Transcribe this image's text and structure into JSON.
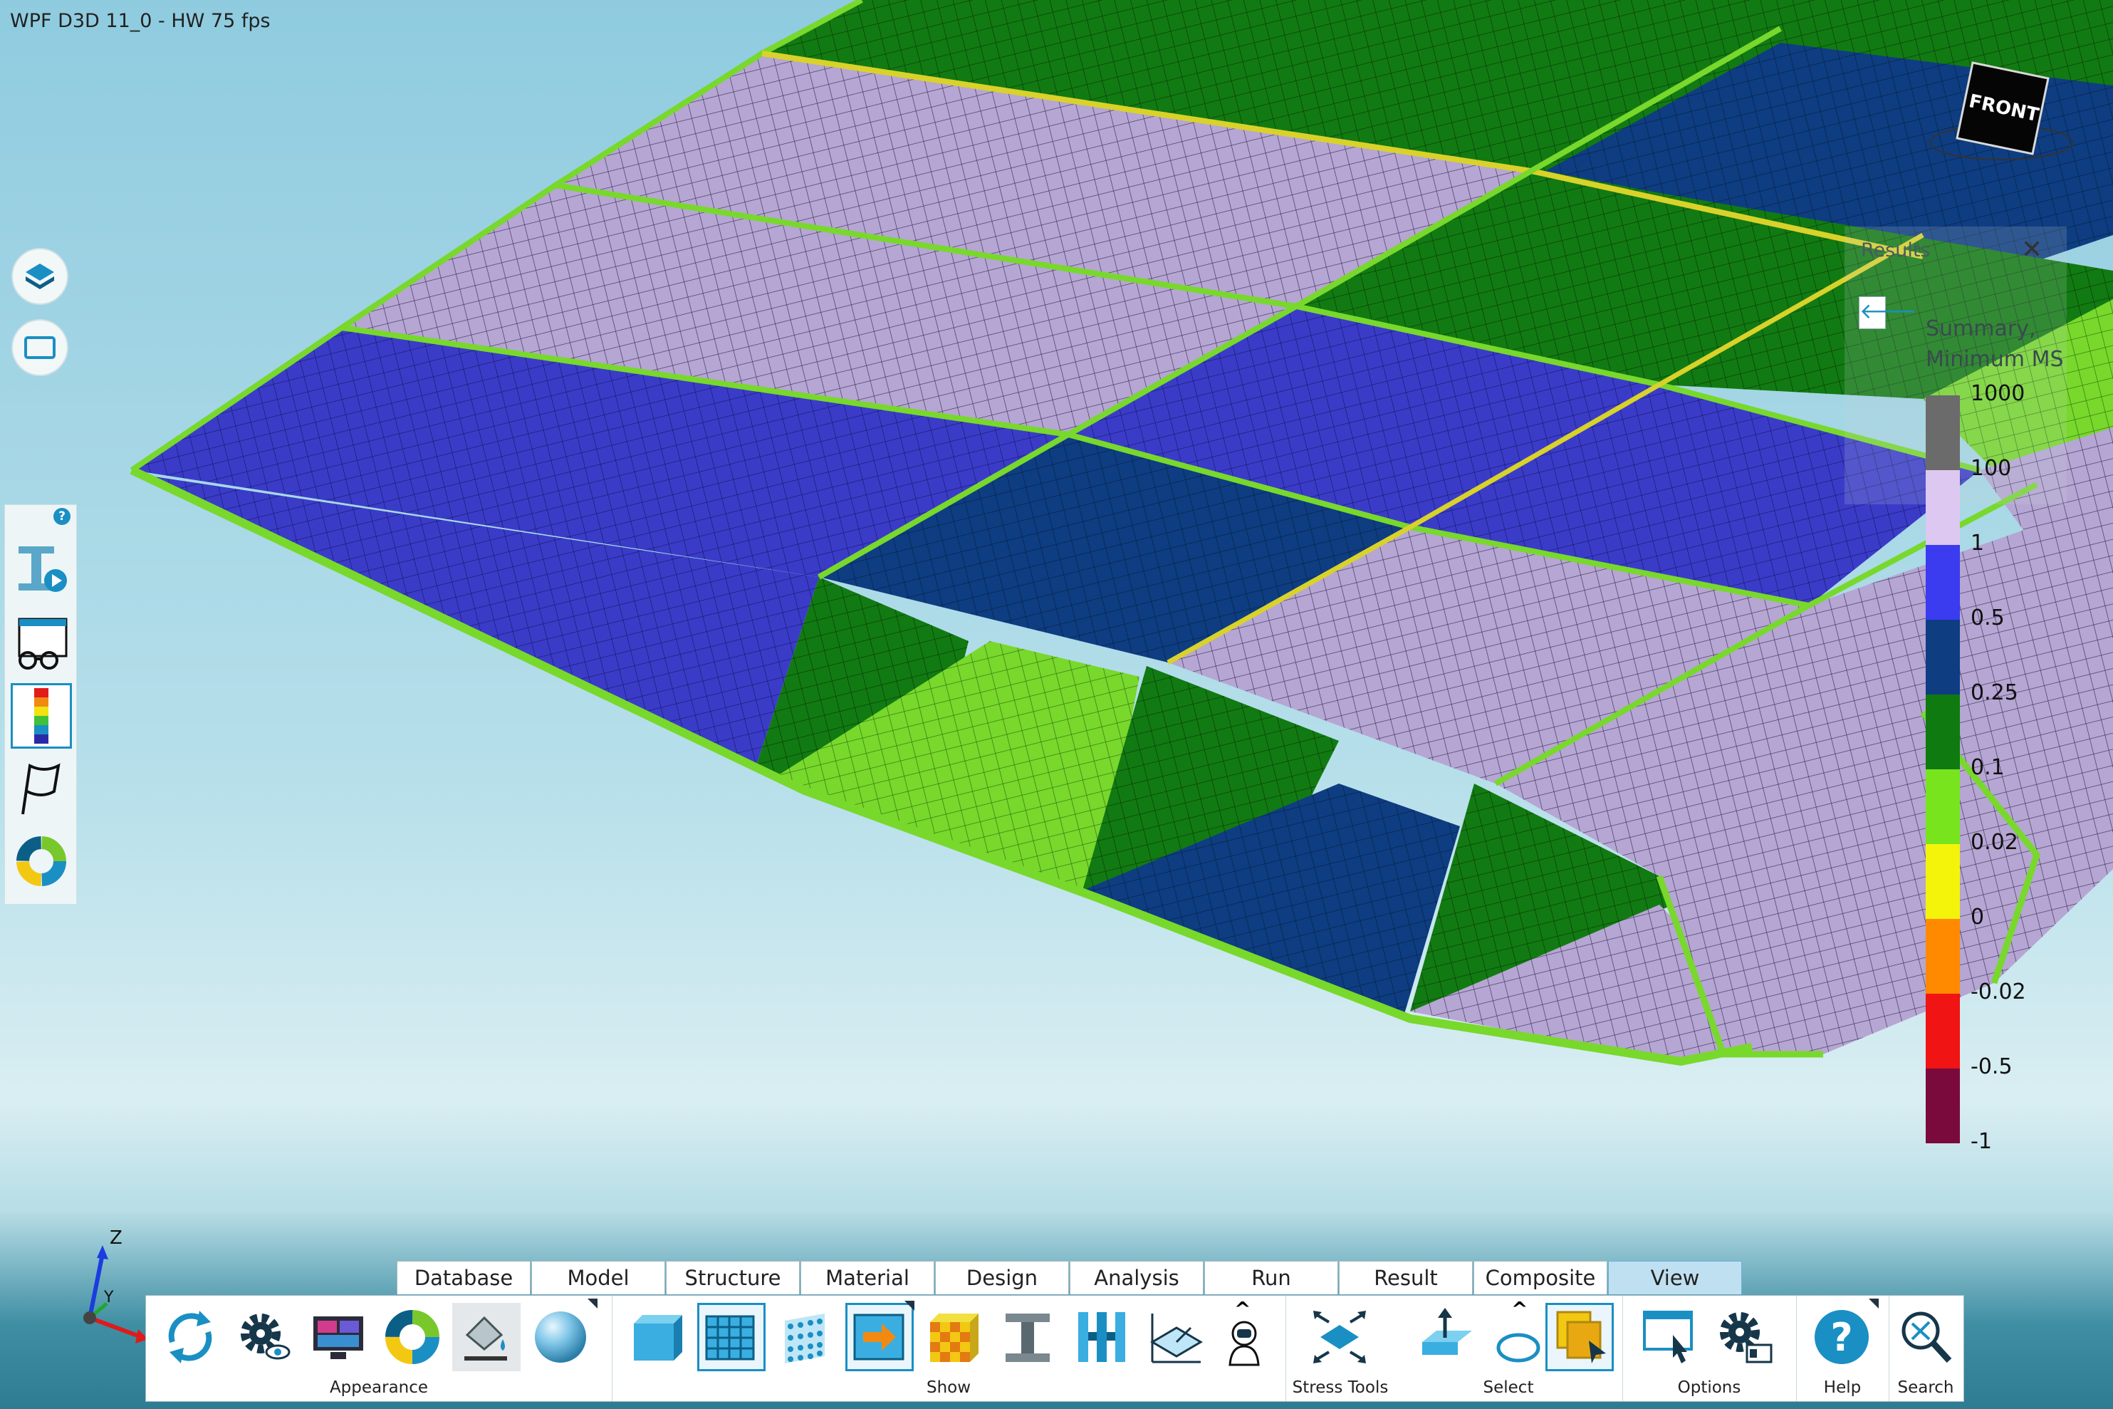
{
  "title_bar": {
    "fps_text": "WPF D3D 11_0 - HW  75  fps"
  },
  "colors": {
    "sky_top": "#8fcbdf",
    "ground": "#2d7c92",
    "accent": "#1a8fc4",
    "mesh_lavender": "#b6a6d3",
    "mesh_blue": "#3a3cc8",
    "mesh_navy": "#0e3d82",
    "mesh_green": "#127a12",
    "mesh_lime": "#78d82c",
    "mesh_yellow": "#d9d22a"
  },
  "side_toolbar": {
    "top_buttons": [
      {
        "name": "layers",
        "icon": "layers-icon"
      },
      {
        "name": "frame",
        "icon": "rectangle-icon"
      }
    ],
    "help_badge": "?",
    "panel_buttons": [
      {
        "name": "beam-play",
        "icon": "beam-play-icon"
      },
      {
        "name": "viewer",
        "icon": "glasses-window-icon"
      },
      {
        "name": "contour",
        "icon": "color-bar-icon",
        "active": true
      },
      {
        "name": "flag",
        "icon": "flag-icon"
      },
      {
        "name": "donut",
        "icon": "donut-chart-icon"
      }
    ]
  },
  "nav_cube": {
    "face_label": "FRONT"
  },
  "results_panel": {
    "title": "Results",
    "close_glyph": "✕",
    "pin_glyph": "🡐",
    "legend_title_line1": "Summary,",
    "legend_title_line2": "Minimum MS",
    "legend": [
      {
        "label": "1000",
        "color": "#6b6b6b"
      },
      {
        "label": "100",
        "color": "#dcc8f0"
      },
      {
        "label": "1",
        "color": "#3b3bf0"
      },
      {
        "label": "0.5",
        "color": "#0e3d82"
      },
      {
        "label": "0.25",
        "color": "#0f7a10"
      },
      {
        "label": "0.1",
        "color": "#78e41e"
      },
      {
        "label": "0.02",
        "color": "#f4f40a"
      },
      {
        "label": "0",
        "color": "#ff8a00"
      },
      {
        "label": "-0.02",
        "color": "#f01414"
      },
      {
        "label": "-0.5",
        "color": "#7a0a3c"
      },
      {
        "label": "-1",
        "color": ""
      }
    ]
  },
  "axes": {
    "z": "Z",
    "y": "Y"
  },
  "ribbon": {
    "tabs": [
      "Database",
      "Model",
      "Structure",
      "Material",
      "Design",
      "Analysis",
      "Run",
      "Result",
      "Composite",
      "View"
    ],
    "active_tab": "View",
    "groups": {
      "appearance": "Appearance",
      "show": "Show",
      "stress_tools": "Stress Tools",
      "select": "Select",
      "options": "Options",
      "help": "Help",
      "search": "Search"
    },
    "expand_glyph": "^"
  }
}
